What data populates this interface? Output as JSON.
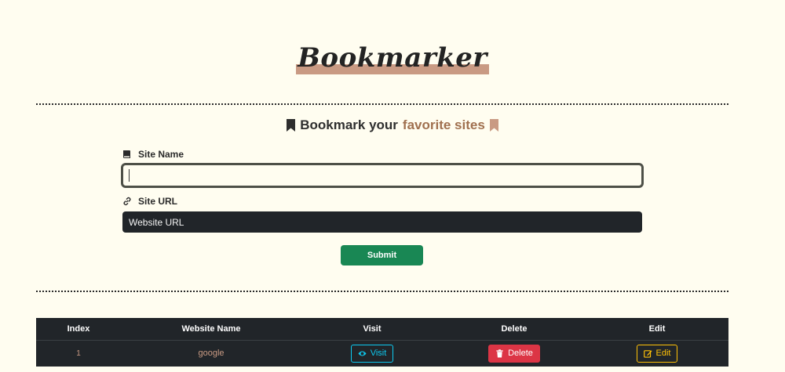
{
  "app": {
    "logo": "Bookmarker"
  },
  "form": {
    "heading_prefix": "Bookmark your",
    "heading_accent": "favorite sites",
    "site_name_label": "Site Name",
    "site_name_value": "",
    "site_url_label": "Site URL",
    "site_url_placeholder": "Website URL",
    "submit_label": "Submit"
  },
  "table": {
    "headers": [
      "Index",
      "Website Name",
      "Visit",
      "Delete",
      "Edit"
    ],
    "rows": [
      {
        "index": "1",
        "name": "google",
        "visit_label": "Visit",
        "delete_label": "Delete",
        "edit_label": "Edit"
      }
    ]
  },
  "colors": {
    "background": "#fffdf0",
    "accent": "#c99a83",
    "submit": "#198754",
    "visit": "#0dcaf0",
    "delete": "#dc3545",
    "edit": "#ffc107",
    "table_bg": "#212529"
  },
  "icons": {
    "heading_left": "bookmark-icon",
    "heading_right": "bookmark-icon",
    "site_name": "book-icon",
    "site_url": "link-icon",
    "visit": "eye-icon",
    "delete": "trash-icon",
    "edit": "edit-icon"
  }
}
